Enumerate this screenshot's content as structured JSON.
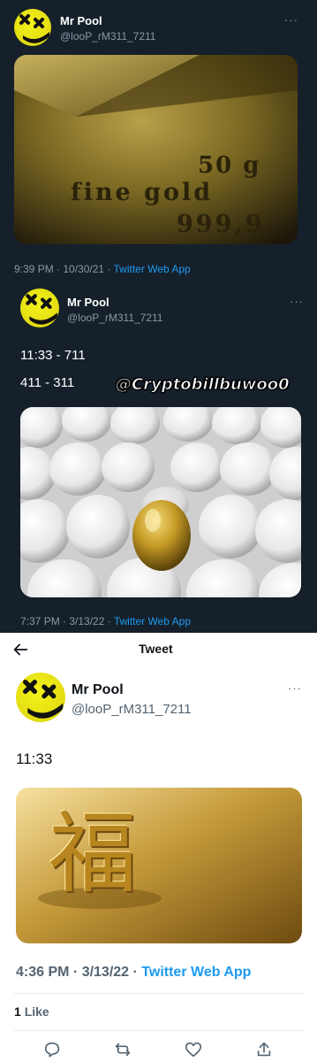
{
  "tweet1": {
    "name": "Mr Pool",
    "handle": "@looP_rM311_7211",
    "more": "···",
    "image_text": [
      "50 g",
      "fine gold",
      "999,9"
    ],
    "time": "9:39 PM · 10/30/21 · ",
    "app": "Twitter Web App"
  },
  "tweet2": {
    "name": "Mr Pool",
    "handle": "@looP_rM311_7211",
    "more": "···",
    "line1": "11:33 - 711",
    "line2": "411 - 311",
    "watermark": "@Cryptobillbuwoo0",
    "time": "7:37 PM · 3/13/22 · ",
    "app": "Twitter Web App"
  },
  "tweet3": {
    "header_title": "Tweet",
    "back_icon": "arrow-left-icon",
    "name": "Mr Pool",
    "handle": "@looP_rM311_7211",
    "more": "···",
    "text": "11:33",
    "image_text": "福",
    "time": "4:36 PM · 3/13/22 · ",
    "app": "Twitter Web App",
    "likes_count": "1",
    "likes_label": "Like",
    "actions": [
      "reply-icon",
      "retweet-icon",
      "like-icon",
      "share-icon"
    ]
  },
  "colors": {
    "dark_bg": "#15202b",
    "link_blue": "#1d9bf0",
    "avatar_yellow": "#e9e313",
    "gold": "#c9a13a"
  }
}
